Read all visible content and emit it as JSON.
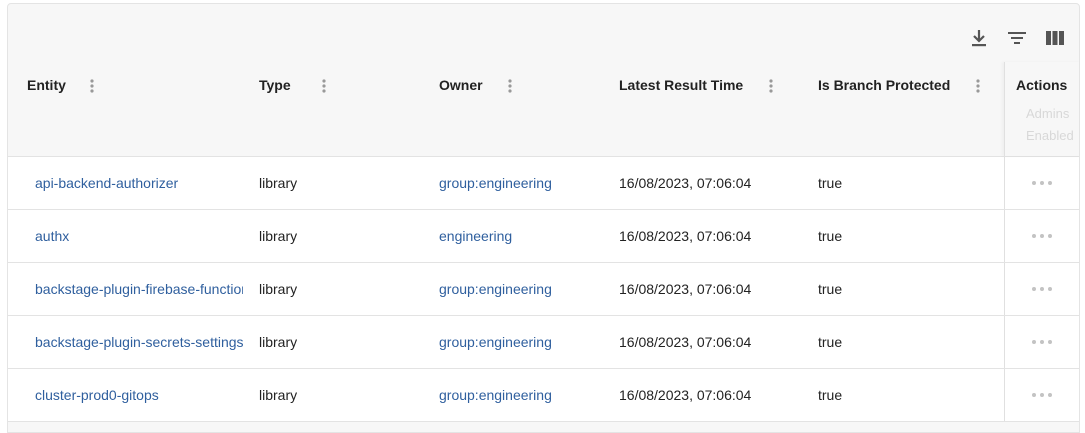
{
  "toolbar": {
    "download_icon": "download-icon",
    "filter_icon": "filter-icon",
    "columns_icon": "view-columns-icon"
  },
  "columns": {
    "entity": "Entity",
    "type": "Type",
    "owner": "Owner",
    "latest_result_time": "Latest Result Time",
    "is_branch_protected": "Is Branch Protected",
    "actions": "Actions"
  },
  "actions_ghost": [
    "Admins",
    "Enabled"
  ],
  "rows": [
    {
      "entity": "api-backend-authorizer",
      "type": "library",
      "owner": "group:engineering",
      "time": "16/08/2023, 07:06:04",
      "protected": "true"
    },
    {
      "entity": "authx",
      "type": "library",
      "owner": "engineering",
      "time": "16/08/2023, 07:06:04",
      "protected": "true"
    },
    {
      "entity": "backstage-plugin-firebase-functions",
      "type": "library",
      "owner": "group:engineering",
      "time": "16/08/2023, 07:06:04",
      "protected": "true"
    },
    {
      "entity": "backstage-plugin-secrets-settings",
      "type": "library",
      "owner": "group:engineering",
      "time": "16/08/2023, 07:06:04",
      "protected": "true"
    },
    {
      "entity": "cluster-prod0-gitops",
      "type": "library",
      "owner": "group:engineering",
      "time": "16/08/2023, 07:06:04",
      "protected": "true"
    }
  ]
}
